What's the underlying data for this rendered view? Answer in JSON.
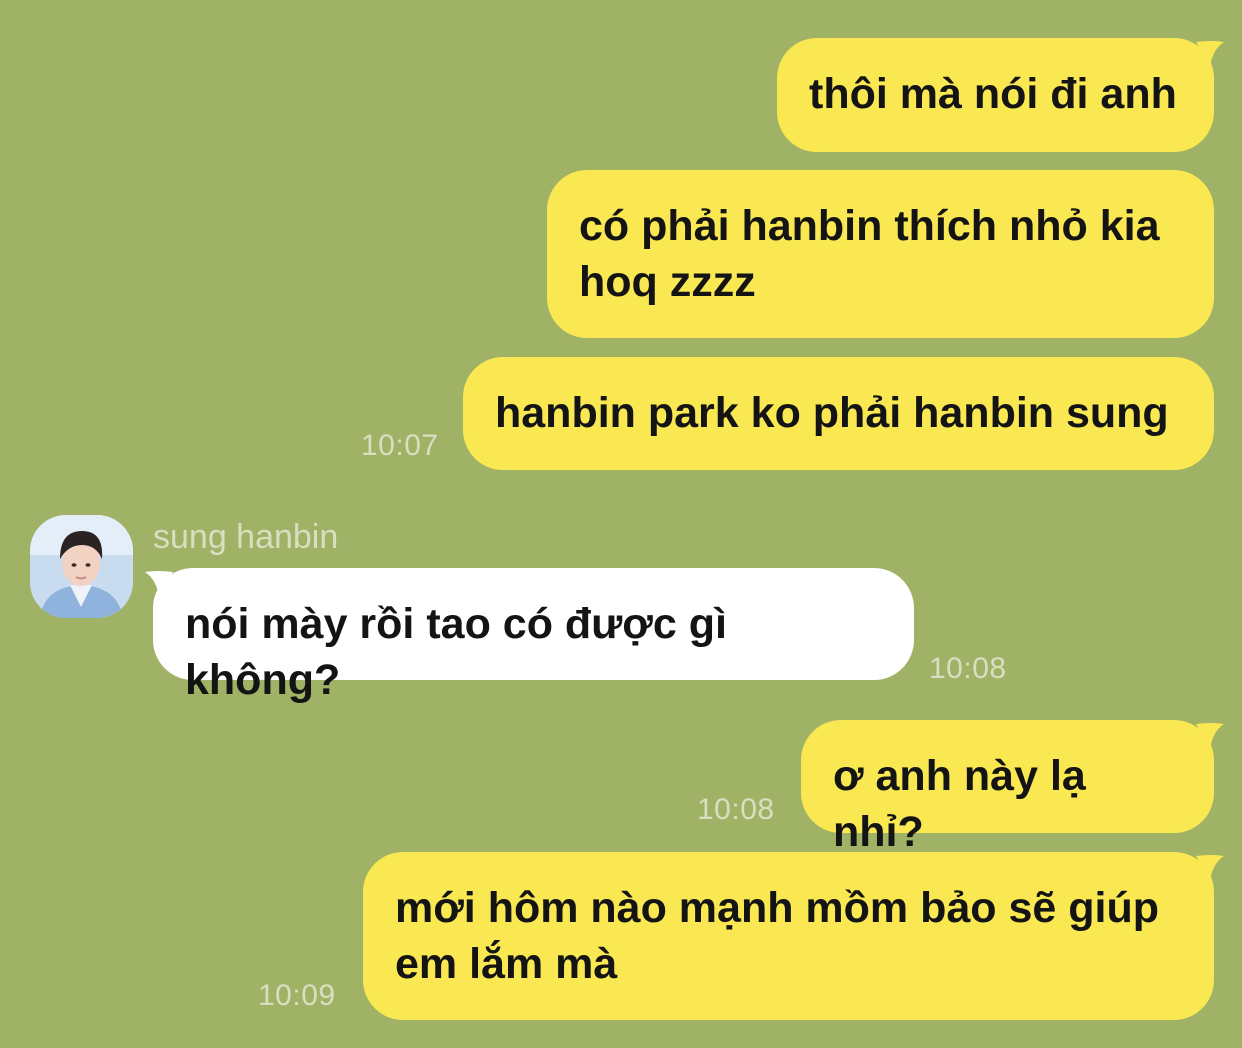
{
  "chat": {
    "contact": {
      "name": "sung hanbin",
      "avatar_icon": "profile-photo"
    },
    "messages": [
      {
        "direction": "outgoing",
        "text": "thôi mà nói đi anh",
        "time": ""
      },
      {
        "direction": "outgoing",
        "text": "có phải hanbin thích nhỏ kia hoq zzzz",
        "time": ""
      },
      {
        "direction": "outgoing",
        "text": "hanbin park ko phải hanbin sung",
        "time": "10:07"
      },
      {
        "direction": "incoming",
        "text": "nói mày rồi tao có được gì không?",
        "time": "10:08"
      },
      {
        "direction": "outgoing",
        "text": "ơ anh này lạ nhỉ?",
        "time": "10:08"
      },
      {
        "direction": "outgoing",
        "text": "mới hôm nào mạnh mồm bảo sẽ giúp em lắm mà",
        "time": "10:09"
      }
    ]
  },
  "colors": {
    "background": "#a0b265",
    "outgoing_bubble": "#f9e852",
    "incoming_bubble": "#ffffff",
    "meta_text": "#d8dfc0"
  }
}
